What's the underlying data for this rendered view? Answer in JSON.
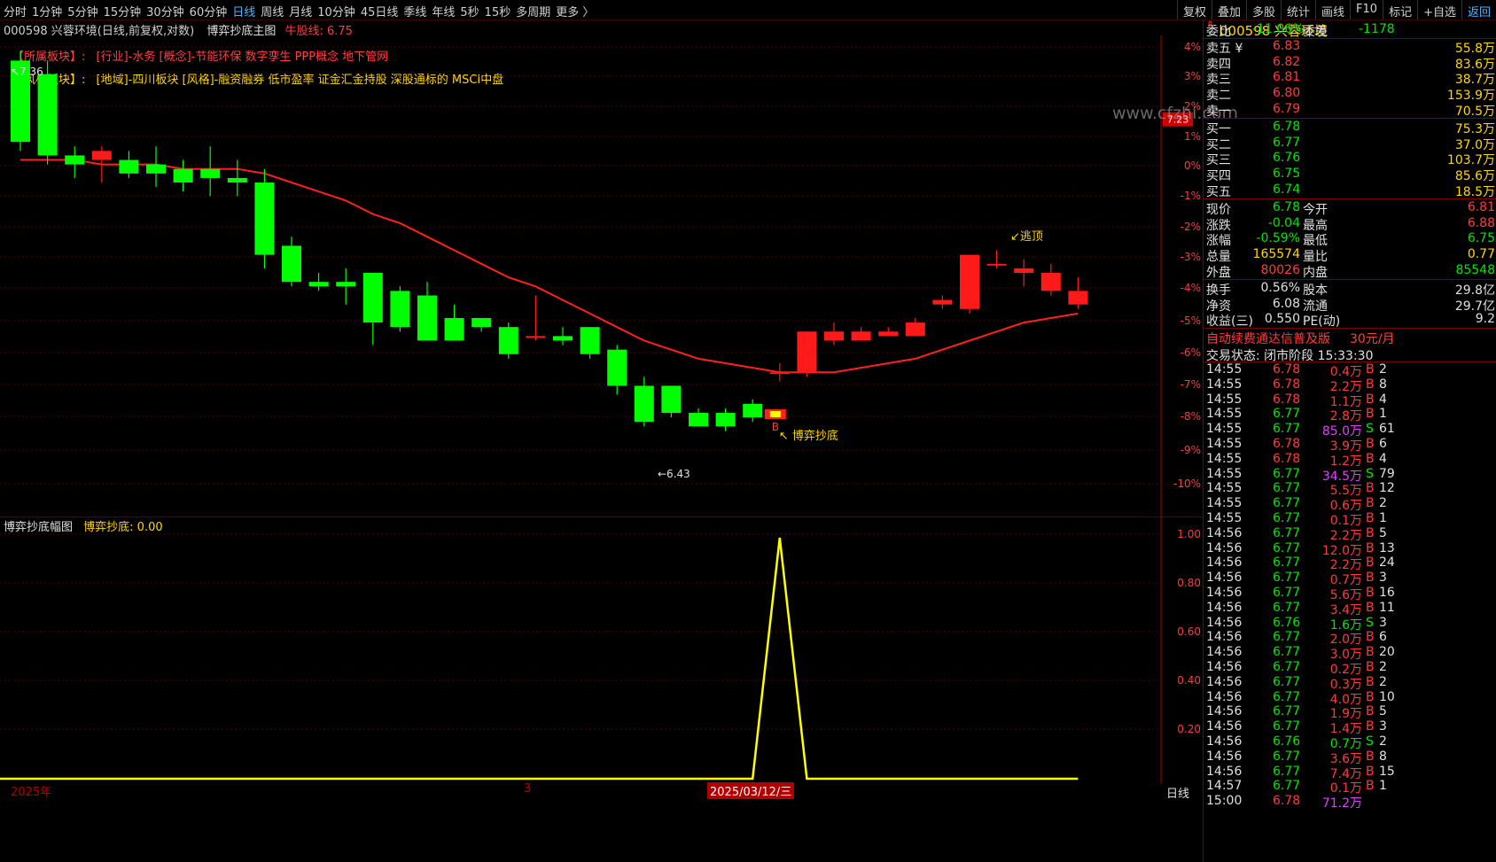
{
  "toolbar": {
    "periods": [
      "分时",
      "1分钟",
      "5分钟",
      "15分钟",
      "30分钟",
      "60分钟",
      "日线",
      "周线",
      "月线",
      "10分钟",
      "45日线",
      "季线",
      "年线",
      "5秒",
      "15秒",
      "多周期",
      "更多 〉"
    ],
    "active_period": "日线",
    "right_tools": [
      "复权",
      "叠加",
      "多股",
      "统计",
      "画线",
      "F10",
      "标记",
      "+自选",
      "返回"
    ]
  },
  "info": {
    "stock": "000598 兴蓉环境(日线,前复权,对数)",
    "indicator": "博弈抄底主图",
    "niu_line": "牛股线: 6.75"
  },
  "sectors": {
    "label1": "【所属板块】:",
    "value1": "[行业]-水务 [概念]-节能环保 数字孪生 PPP概念 地下管网",
    "label2": "【风格板块】:",
    "value2": "[地域]-四川板块 [风格]-融资融券 低市盈率 证金汇金持股 深股通标的 MSCI中盘"
  },
  "chart_data": {
    "type": "candlestick",
    "ylabels_pct": [
      "4%",
      "3%",
      "2%",
      "1%",
      "0%",
      "-1%",
      "-2%",
      "-3%",
      "-4%",
      "-5%",
      "-6%",
      "-7%",
      "-8%",
      "-9%",
      "-10%"
    ],
    "current_price_tag": "7.23",
    "annotations": {
      "high": "7.36",
      "low": "6.43",
      "buy_signal": "博弈抄底",
      "buy_letter": "B",
      "sell_signal": "逃顶"
    },
    "candles": [
      {
        "o": 7.36,
        "h": 7.38,
        "c": 7.18,
        "l": 7.16
      },
      {
        "o": 7.33,
        "h": 7.36,
        "c": 7.15,
        "l": 7.13
      },
      {
        "o": 7.15,
        "h": 7.17,
        "c": 7.13,
        "l": 7.1
      },
      {
        "o": 7.14,
        "h": 7.17,
        "c": 7.16,
        "l": 7.09
      },
      {
        "o": 7.14,
        "h": 7.16,
        "c": 7.11,
        "l": 7.1
      },
      {
        "o": 7.13,
        "h": 7.17,
        "c": 7.11,
        "l": 7.08
      },
      {
        "o": 7.12,
        "h": 7.14,
        "c": 7.09,
        "l": 7.07
      },
      {
        "o": 7.12,
        "h": 7.17,
        "c": 7.1,
        "l": 7.06
      },
      {
        "o": 7.1,
        "h": 7.14,
        "c": 7.09,
        "l": 7.06
      },
      {
        "o": 7.09,
        "h": 7.12,
        "c": 6.93,
        "l": 6.9
      },
      {
        "o": 6.95,
        "h": 6.97,
        "c": 6.87,
        "l": 6.86
      },
      {
        "o": 6.87,
        "h": 6.89,
        "c": 6.86,
        "l": 6.85
      },
      {
        "o": 6.87,
        "h": 6.9,
        "c": 6.86,
        "l": 6.82
      },
      {
        "o": 6.89,
        "h": 6.89,
        "c": 6.78,
        "l": 6.73
      },
      {
        "o": 6.85,
        "h": 6.86,
        "c": 6.77,
        "l": 6.76
      },
      {
        "o": 6.84,
        "h": 6.87,
        "c": 6.74,
        "l": 6.74
      },
      {
        "o": 6.79,
        "h": 6.82,
        "c": 6.74,
        "l": 6.74
      },
      {
        "o": 6.79,
        "h": 6.79,
        "c": 6.77,
        "l": 6.76
      },
      {
        "o": 6.77,
        "h": 6.78,
        "c": 6.71,
        "l": 6.7
      },
      {
        "o": 6.75,
        "h": 6.84,
        "c": 6.75,
        "l": 6.74
      },
      {
        "o": 6.75,
        "h": 6.77,
        "c": 6.74,
        "l": 6.73
      },
      {
        "o": 6.77,
        "h": 6.77,
        "c": 6.71,
        "l": 6.7
      },
      {
        "o": 6.72,
        "h": 6.73,
        "c": 6.64,
        "l": 6.62
      },
      {
        "o": 6.64,
        "h": 6.66,
        "c": 6.56,
        "l": 6.55
      },
      {
        "o": 6.64,
        "h": 6.64,
        "c": 6.58,
        "l": 6.57
      },
      {
        "o": 6.58,
        "h": 6.59,
        "c": 6.55,
        "l": 6.55
      },
      {
        "o": 6.58,
        "h": 6.59,
        "c": 6.55,
        "l": 6.54
      },
      {
        "o": 6.6,
        "h": 6.61,
        "c": 6.57,
        "l": 6.56
      },
      {
        "o": 6.67,
        "h": 6.69,
        "c": 6.67,
        "l": 6.65
      },
      {
        "o": 6.67,
        "h": 6.73,
        "c": 6.76,
        "l": 6.66
      },
      {
        "o": 6.74,
        "h": 6.78,
        "c": 6.76,
        "l": 6.73
      },
      {
        "o": 6.74,
        "h": 6.77,
        "c": 6.76,
        "l": 6.74
      },
      {
        "o": 6.75,
        "h": 6.77,
        "c": 6.76,
        "l": 6.75
      },
      {
        "o": 6.75,
        "h": 6.79,
        "c": 6.78,
        "l": 6.75
      },
      {
        "o": 6.82,
        "h": 6.84,
        "c": 6.83,
        "l": 6.81
      },
      {
        "o": 6.81,
        "h": 6.89,
        "c": 6.93,
        "l": 6.8
      },
      {
        "o": 6.91,
        "h": 6.94,
        "c": 6.91,
        "l": 6.9
      },
      {
        "o": 6.89,
        "h": 6.92,
        "c": 6.9,
        "l": 6.86
      },
      {
        "o": 6.85,
        "h": 6.91,
        "c": 6.89,
        "l": 6.84
      },
      {
        "o": 6.82,
        "h": 6.88,
        "c": 6.85,
        "l": 6.81
      }
    ],
    "ma": [
      7.14,
      7.14,
      7.14,
      7.13,
      7.13,
      7.13,
      7.12,
      7.12,
      7.12,
      7.11,
      7.09,
      7.07,
      7.05,
      7.02,
      7.0,
      6.97,
      6.94,
      6.91,
      6.88,
      6.86,
      6.83,
      6.8,
      6.77,
      6.74,
      6.72,
      6.7,
      6.69,
      6.68,
      6.67,
      6.67,
      6.67,
      6.68,
      6.69,
      6.7,
      6.72,
      6.74,
      6.76,
      6.78,
      6.79,
      6.8
    ],
    "sub_indicator": {
      "name": "博弈抄底幅图",
      "series_label": "博弈抄底: 0.00",
      "ylabels": [
        "1.00",
        "0.80",
        "0.60",
        "0.40",
        "0.20"
      ],
      "signal_index": 28,
      "signal_value": 1.0
    },
    "x_labels": [
      "2025年",
      "3",
      "2025/03/12/三"
    ],
    "bottom_tab": "日线"
  },
  "quote": {
    "title": "000598 兴蓉环境",
    "r_mark": "R\n500",
    "weibi": {
      "label": "委比",
      "value": "-11.06%",
      "label2": "委差",
      "value2": "-1178"
    },
    "sell": [
      {
        "label": "卖五 ¥",
        "price": "6.83",
        "vol": "55.8万"
      },
      {
        "label": "卖四",
        "price": "6.82",
        "vol": "83.6万"
      },
      {
        "label": "卖三",
        "price": "6.81",
        "vol": "38.7万"
      },
      {
        "label": "卖二",
        "price": "6.80",
        "vol": "153.9万"
      },
      {
        "label": "卖一",
        "price": "6.79",
        "vol": "70.5万"
      }
    ],
    "buy": [
      {
        "label": "买一",
        "price": "6.78",
        "vol": "75.3万"
      },
      {
        "label": "买二",
        "price": "6.77",
        "vol": "37.0万"
      },
      {
        "label": "买三",
        "price": "6.76",
        "vol": "103.7万"
      },
      {
        "label": "买四",
        "price": "6.75",
        "vol": "85.6万"
      },
      {
        "label": "买五",
        "price": "6.74",
        "vol": "18.5万"
      }
    ],
    "stats": [
      {
        "l1": "现价",
        "v1": "6.78",
        "c1": "green",
        "l2": "今开",
        "v2": "6.81",
        "c2": "red"
      },
      {
        "l1": "涨跌",
        "v1": "-0.04",
        "c1": "green",
        "l2": "最高",
        "v2": "6.88",
        "c2": "red"
      },
      {
        "l1": "涨幅",
        "v1": "-0.59%",
        "c1": "green",
        "l2": "最低",
        "v2": "6.75",
        "c2": "green"
      },
      {
        "l1": "总量",
        "v1": "165574",
        "c1": "yellow",
        "l2": "量比",
        "v2": "0.77",
        "c2": "yellow"
      },
      {
        "l1": "外盘",
        "v1": "80026",
        "c1": "red",
        "l2": "内盘",
        "v2": "85548",
        "c2": "green"
      }
    ],
    "stats2": [
      {
        "l1": "换手",
        "v1": "0.56%",
        "l2": "股本",
        "v2": "29.8亿"
      },
      {
        "l1": "净资",
        "v1": "6.08",
        "l2": "流通",
        "v2": "29.7亿"
      },
      {
        "l1": "收益(三)",
        "v1": "0.550",
        "l2": "PE(动)",
        "v2": "9.2"
      }
    ],
    "ad_text": "自动续费通达信普及版",
    "ad_price": "30元/月",
    "status": "交易状态: 闭市阶段 15:33:30",
    "ticks": [
      {
        "t": "14:55",
        "p": "6.78",
        "pc": "red",
        "v": "0.4万",
        "vc": "red",
        "s": "B",
        "n": "2"
      },
      {
        "t": "14:55",
        "p": "6.78",
        "pc": "red",
        "v": "2.2万",
        "vc": "red",
        "s": "B",
        "n": "8"
      },
      {
        "t": "14:55",
        "p": "6.78",
        "pc": "red",
        "v": "1.1万",
        "vc": "red",
        "s": "B",
        "n": "4"
      },
      {
        "t": "14:55",
        "p": "6.77",
        "pc": "green",
        "v": "2.8万",
        "vc": "red",
        "s": "B",
        "n": "1"
      },
      {
        "t": "14:55",
        "p": "6.77",
        "pc": "green",
        "v": "85.0万",
        "vc": "purple",
        "s": "S",
        "n": "61"
      },
      {
        "t": "14:55",
        "p": "6.78",
        "pc": "red",
        "v": "3.9万",
        "vc": "red",
        "s": "B",
        "n": "6"
      },
      {
        "t": "14:55",
        "p": "6.78",
        "pc": "red",
        "v": "1.2万",
        "vc": "red",
        "s": "B",
        "n": "4"
      },
      {
        "t": "14:55",
        "p": "6.77",
        "pc": "green",
        "v": "34.5万",
        "vc": "purple",
        "s": "S",
        "n": "79"
      },
      {
        "t": "14:55",
        "p": "6.77",
        "pc": "green",
        "v": "5.5万",
        "vc": "red",
        "s": "B",
        "n": "12"
      },
      {
        "t": "14:55",
        "p": "6.77",
        "pc": "green",
        "v": "0.6万",
        "vc": "red",
        "s": "B",
        "n": "2"
      },
      {
        "t": "14:55",
        "p": "6.77",
        "pc": "green",
        "v": "0.1万",
        "vc": "red",
        "s": "B",
        "n": "1"
      },
      {
        "t": "14:56",
        "p": "6.77",
        "pc": "green",
        "v": "2.2万",
        "vc": "red",
        "s": "B",
        "n": "5"
      },
      {
        "t": "14:56",
        "p": "6.77",
        "pc": "green",
        "v": "12.0万",
        "vc": "red",
        "s": "B",
        "n": "13"
      },
      {
        "t": "14:56",
        "p": "6.77",
        "pc": "green",
        "v": "2.2万",
        "vc": "red",
        "s": "B",
        "n": "24"
      },
      {
        "t": "14:56",
        "p": "6.77",
        "pc": "green",
        "v": "0.7万",
        "vc": "red",
        "s": "B",
        "n": "3"
      },
      {
        "t": "14:56",
        "p": "6.77",
        "pc": "green",
        "v": "5.6万",
        "vc": "red",
        "s": "B",
        "n": "16"
      },
      {
        "t": "14:56",
        "p": "6.77",
        "pc": "green",
        "v": "3.4万",
        "vc": "red",
        "s": "B",
        "n": "11"
      },
      {
        "t": "14:56",
        "p": "6.76",
        "pc": "green",
        "v": "1.6万",
        "vc": "green",
        "s": "S",
        "n": "3"
      },
      {
        "t": "14:56",
        "p": "6.77",
        "pc": "green",
        "v": "2.0万",
        "vc": "red",
        "s": "B",
        "n": "6"
      },
      {
        "t": "14:56",
        "p": "6.77",
        "pc": "green",
        "v": "3.0万",
        "vc": "red",
        "s": "B",
        "n": "20"
      },
      {
        "t": "14:56",
        "p": "6.77",
        "pc": "green",
        "v": "0.2万",
        "vc": "red",
        "s": "B",
        "n": "2"
      },
      {
        "t": "14:56",
        "p": "6.77",
        "pc": "green",
        "v": "0.3万",
        "vc": "red",
        "s": "B",
        "n": "2"
      },
      {
        "t": "14:56",
        "p": "6.77",
        "pc": "green",
        "v": "4.0万",
        "vc": "red",
        "s": "B",
        "n": "10"
      },
      {
        "t": "14:56",
        "p": "6.77",
        "pc": "green",
        "v": "1.9万",
        "vc": "red",
        "s": "B",
        "n": "5"
      },
      {
        "t": "14:56",
        "p": "6.77",
        "pc": "green",
        "v": "1.4万",
        "vc": "red",
        "s": "B",
        "n": "3"
      },
      {
        "t": "14:56",
        "p": "6.76",
        "pc": "green",
        "v": "0.7万",
        "vc": "green",
        "s": "S",
        "n": "2"
      },
      {
        "t": "14:56",
        "p": "6.77",
        "pc": "green",
        "v": "3.6万",
        "vc": "red",
        "s": "B",
        "n": "8"
      },
      {
        "t": "14:56",
        "p": "6.77",
        "pc": "green",
        "v": "7.4万",
        "vc": "red",
        "s": "B",
        "n": "15"
      },
      {
        "t": "14:57",
        "p": "6.77",
        "pc": "green",
        "v": "0.1万",
        "vc": "red",
        "s": "B",
        "n": "1"
      },
      {
        "t": "15:00",
        "p": "6.78",
        "pc": "red",
        "v": "71.2万",
        "vc": "purple",
        "s": "",
        "n": ""
      }
    ]
  },
  "watermark": "www.cfzhi.com"
}
